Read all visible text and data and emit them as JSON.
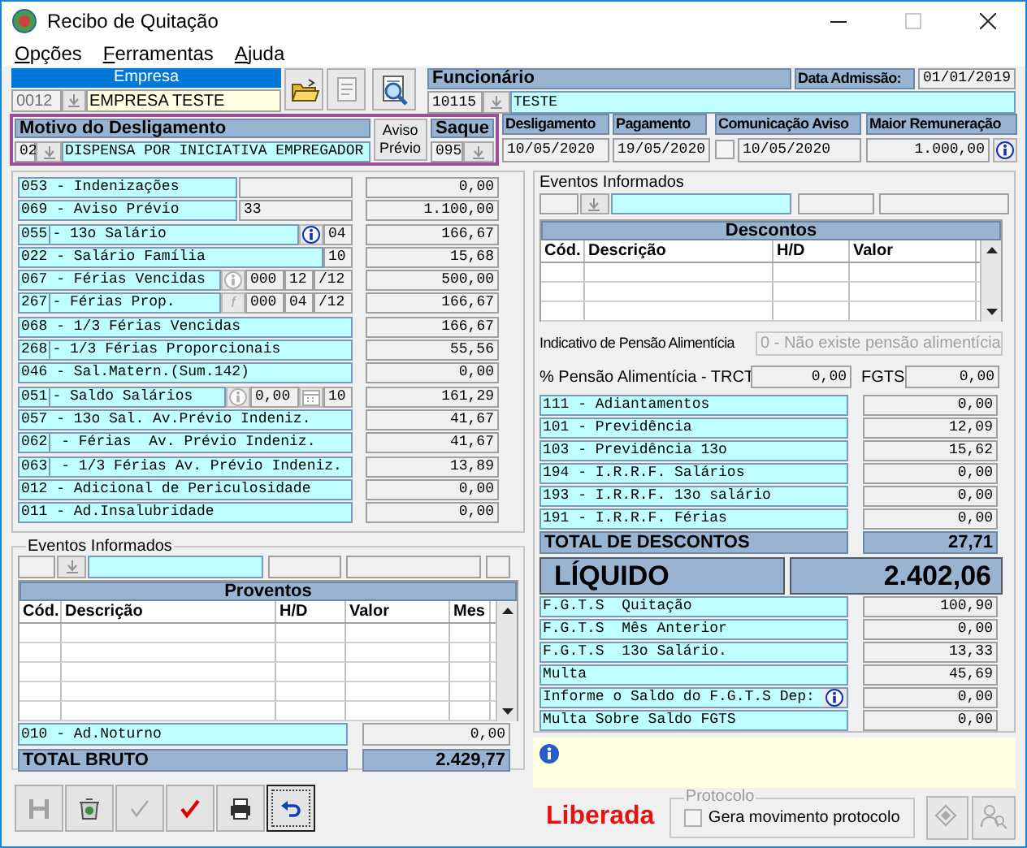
{
  "window": {
    "title": "Recibo de Quitação",
    "controls": [
      {
        "kind": "minimize",
        "disabled": false
      },
      {
        "kind": "maximize",
        "disabled": true
      },
      {
        "kind": "close",
        "disabled": false
      }
    ]
  },
  "menu": [
    {
      "label": "Opções"
    },
    {
      "label": "Ferramentas"
    },
    {
      "label": "Ajuda"
    }
  ],
  "empresa": {
    "label": "Empresa",
    "code": "0012",
    "name": "EMPRESA TESTE"
  },
  "toolbar_top": [
    {
      "kind": "open",
      "disabled": false
    },
    {
      "kind": "document",
      "disabled": true
    },
    {
      "kind": "search",
      "disabled": false
    }
  ],
  "funcionario": {
    "label": "Funcionário",
    "code": "10115",
    "name": "TESTE",
    "admission_label": "Data Admissão:",
    "admission_date": "01/01/2019"
  },
  "motivo": {
    "label": "Motivo do Desligamento",
    "code": "02",
    "description": "DISPENSA POR INICIATIVA EMPREGADOR",
    "aviso_button": "Aviso Prévio",
    "saque_label": "Saque",
    "saque_code": "095"
  },
  "dates": [
    {
      "kind": "date",
      "label": "Desligamento",
      "value": "10/05/2020"
    },
    {
      "kind": "date",
      "label": "Pagamento",
      "value": "19/05/2020"
    },
    {
      "kind": "checkbox",
      "label": "Comunicação Aviso",
      "value": "10/05/2020",
      "checked": false
    },
    {
      "kind": "info",
      "label": "Maior Remuneração",
      "value": "1.000,00"
    }
  ],
  "proventos_list": [
    {
      "label": "053 - Indenizações",
      "value": "0,00",
      "extras": [
        {
          "kind": "wide-field"
        }
      ]
    },
    {
      "label": "069 - Aviso Prévio",
      "value": "1.100,00",
      "extras": [
        {
          "kind": "wide-field",
          "text": "33"
        }
      ]
    },
    {
      "code": "055",
      "label": "- 13o Salário",
      "value": "166,67",
      "extras": [
        {
          "kind": "info-button",
          "disabled": false
        },
        {
          "kind": "field",
          "text": "04"
        }
      ]
    },
    {
      "label": "022 - Salário Família",
      "value": "15,68",
      "extras": [
        {
          "kind": "field",
          "text": "10"
        }
      ]
    },
    {
      "label": "067 - Férias Vencidas",
      "value": "500,00",
      "extras": [
        {
          "kind": "info-button",
          "disabled": true
        },
        {
          "kind": "field",
          "text": "000"
        },
        {
          "kind": "field",
          "text": "12"
        },
        {
          "kind": "field",
          "text": "/12"
        }
      ]
    },
    {
      "code": "267",
      "label": "- Férias Prop.",
      "value": "166,67",
      "extras": [
        {
          "kind": "letter-button",
          "text": "f",
          "disabled": true
        },
        {
          "kind": "field",
          "text": "000"
        },
        {
          "kind": "field",
          "text": "04"
        },
        {
          "kind": "field",
          "text": "/12"
        }
      ]
    },
    {
      "label": "068 - 1/3 Férias Vencidas",
      "value": "166,67"
    },
    {
      "code": "268",
      "label": "- 1/3 Férias Proporcionais",
      "value": "55,56"
    },
    {
      "label": "046 - Sal.Matern.(Sum.142)",
      "value": "0,00"
    },
    {
      "code": "051",
      "label": "- Saldo Salários",
      "value": "161,29",
      "extras": [
        {
          "kind": "info-button",
          "disabled": true
        },
        {
          "kind": "field",
          "text": "0,00"
        },
        {
          "kind": "calendar-button",
          "disabled": true
        },
        {
          "kind": "field",
          "text": "10"
        }
      ]
    },
    {
      "label": "057 - 13o Sal. Av.Prévio Indeniz.",
      "value": "41,67"
    },
    {
      "code": "062",
      "label": " - Férias  Av. Prévio Indeniz.",
      "value": "41,67"
    },
    {
      "code": "063",
      "label": " - 1/3 Férias Av. Prévio Indeniz.",
      "value": "13,89"
    },
    {
      "label": "012 - Adicional de Periculosidade",
      "value": "0,00"
    },
    {
      "label": "011 - Ad.Insalubridade",
      "value": "0,00"
    }
  ],
  "eventos_descontos": {
    "label": "Eventos Informados"
  },
  "descontos_grid": {
    "title": "Descontos",
    "columns": [
      "Cód.",
      "Descrição",
      "H/D",
      "Valor"
    ]
  },
  "pensao": {
    "label": "Indicativo de Pensão Alimentícia",
    "value": "0 - Não existe pensão alimentícia",
    "disabled": true
  },
  "pensao_pct": {
    "label": "% Pensão Alimentícia - TRCT",
    "value": "0,00"
  },
  "fgts": {
    "label": "FGTS",
    "value": "0,00"
  },
  "descontos": [
    {
      "label": "111 - Adiantamentos",
      "value": "0,00"
    },
    {
      "label": "101 - Previdência",
      "value": "12,09"
    },
    {
      "label": "103 - Previdência 13o",
      "value": "15,62"
    },
    {
      "label": "194 - I.R.R.F. Salários",
      "value": "0,00"
    },
    {
      "label": "193 - I.R.R.F. 13o salário",
      "value": "0,00"
    },
    {
      "label": "191 - I.R.R.F. Férias",
      "value": "0,00"
    }
  ],
  "total_descontos": {
    "label": "TOTAL DE DESCONTOS",
    "value": "27,71"
  },
  "liquido": {
    "label": "LÍQUIDO",
    "value": "2.402,06"
  },
  "fgts_rows": [
    {
      "kind": "plain",
      "label": "F.G.T.S  Quitação",
      "value": "100,90"
    },
    {
      "kind": "plain",
      "label": "F.G.T.S  Mês Anterior",
      "value": "0,00"
    },
    {
      "kind": "plain",
      "label": "F.G.T.S  13o Salário.",
      "value": "13,33"
    },
    {
      "kind": "plain",
      "label": "Multa",
      "value": "45,69"
    },
    {
      "kind": "info",
      "label": "Informe o Saldo do F.G.T.S Dep:",
      "value": "0,00"
    },
    {
      "kind": "plain",
      "label": "Multa Sobre Saldo FGTS",
      "value": "0,00"
    }
  ],
  "eventos_proventos": {
    "label": "Eventos Informados"
  },
  "proventos_grid": {
    "title": "Proventos",
    "columns": [
      "Cód.",
      "Descrição",
      "H/D",
      "Valor",
      "Mes"
    ]
  },
  "ad_noturno": {
    "label": "010 - Ad.Noturno",
    "value": "0,00"
  },
  "total_bruto": {
    "label": "TOTAL BRUTO",
    "value": "2.429,77"
  },
  "toolbar": [
    {
      "kind": "save",
      "disabled": true,
      "focused": false
    },
    {
      "kind": "delete",
      "disabled": false,
      "focused": false
    },
    {
      "kind": "check",
      "disabled": true,
      "focused": false
    },
    {
      "kind": "confirm",
      "disabled": false,
      "focused": false
    },
    {
      "kind": "print",
      "disabled": false,
      "focused": false
    },
    {
      "kind": "undo",
      "disabled": false,
      "focused": true
    }
  ],
  "status": "Liberada",
  "protocolo": {
    "label": "Protocolo",
    "checkbox_label": "Gera movimento protocolo",
    "checked": false,
    "disabled": true
  },
  "side_buttons": [
    {
      "kind": "diamond",
      "disabled": true
    },
    {
      "kind": "person",
      "disabled": true
    }
  ]
}
